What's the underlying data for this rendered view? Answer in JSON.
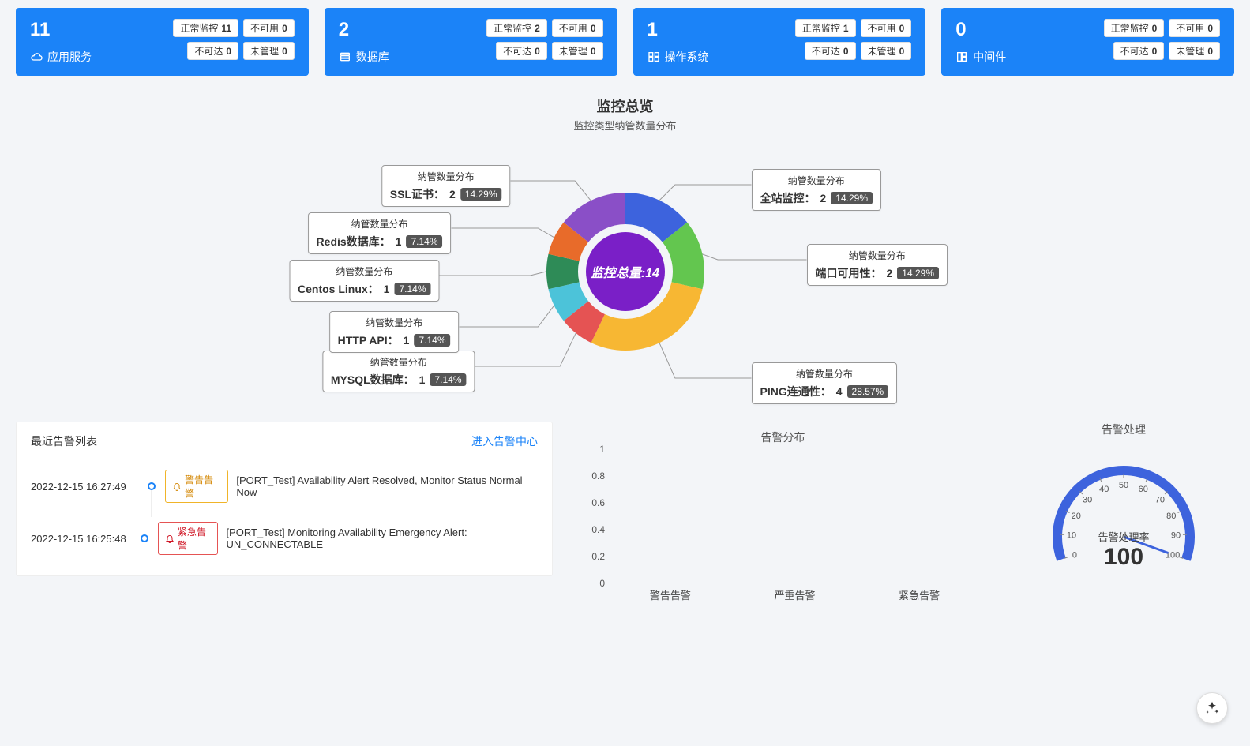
{
  "cards": [
    {
      "count": "11",
      "name": "应用服务",
      "tags": [
        {
          "label": "正常监控",
          "val": "11"
        },
        {
          "label": "不可用",
          "val": "0"
        },
        {
          "label": "不可达",
          "val": "0"
        },
        {
          "label": "未管理",
          "val": "0"
        }
      ]
    },
    {
      "count": "2",
      "name": "数据库",
      "tags": [
        {
          "label": "正常监控",
          "val": "2"
        },
        {
          "label": "不可用",
          "val": "0"
        },
        {
          "label": "不可达",
          "val": "0"
        },
        {
          "label": "未管理",
          "val": "0"
        }
      ]
    },
    {
      "count": "1",
      "name": "操作系统",
      "tags": [
        {
          "label": "正常监控",
          "val": "1"
        },
        {
          "label": "不可用",
          "val": "0"
        },
        {
          "label": "不可达",
          "val": "0"
        },
        {
          "label": "未管理",
          "val": "0"
        }
      ]
    },
    {
      "count": "0",
      "name": "中间件",
      "tags": [
        {
          "label": "正常监控",
          "val": "0"
        },
        {
          "label": "不可用",
          "val": "0"
        },
        {
          "label": "不可达",
          "val": "0"
        },
        {
          "label": "未管理",
          "val": "0"
        }
      ]
    }
  ],
  "overview": {
    "title": "监控总览",
    "subtitle": "监控类型纳管数量分布",
    "center_prefix": "监控总量:",
    "center_value": "14",
    "label_title": "纳管数量分布"
  },
  "chart_data": {
    "type": "pie",
    "title": "监控类型纳管数量分布",
    "total": 14,
    "series": [
      {
        "name": "全站监控",
        "value": 2,
        "percent": "14.29%",
        "color": "#3d63dd"
      },
      {
        "name": "端口可用性",
        "value": 2,
        "percent": "14.29%",
        "color": "#63c64f"
      },
      {
        "name": "PING连通性",
        "value": 4,
        "percent": "28.57%",
        "color": "#f7b733"
      },
      {
        "name": "MYSQL数据库",
        "value": 1,
        "percent": "7.14%",
        "color": "#e55353"
      },
      {
        "name": "HTTP API",
        "value": 1,
        "percent": "7.14%",
        "color": "#4cc3d9"
      },
      {
        "name": "Centos Linux",
        "value": 1,
        "percent": "7.14%",
        "color": "#2e8b57"
      },
      {
        "name": "Redis数据库",
        "value": 1,
        "percent": "7.14%",
        "color": "#e86b2a"
      },
      {
        "name": "SSL证书",
        "value": 2,
        "percent": "14.29%",
        "color": "#8a4fc7"
      }
    ]
  },
  "alerts": {
    "title": "最近告警列表",
    "link": "进入告警中心",
    "items": [
      {
        "time": "2022-12-15 16:27:49",
        "level_label": "警告告警",
        "level": "warn",
        "msg": "[PORT_Test] Availability Alert Resolved, Monitor Status Normal Now"
      },
      {
        "time": "2022-12-15 16:25:48",
        "level_label": "紧急告警",
        "level": "crit",
        "msg": "[PORT_Test] Monitoring Availability Emergency Alert: UN_CONNECTABLE"
      }
    ]
  },
  "dist_chart": {
    "title": "告警分布",
    "type": "bar",
    "categories": [
      "警告告警",
      "严重告警",
      "紧急告警"
    ],
    "values": [
      0,
      0,
      0
    ],
    "ylim": [
      0,
      1
    ],
    "yticks": [
      "0",
      "0.2",
      "0.4",
      "0.6",
      "0.8",
      "1"
    ]
  },
  "gauge": {
    "title": "告警处理",
    "label": "告警处理率",
    "value": "100",
    "ticks": [
      "0",
      "10",
      "20",
      "30",
      "40",
      "50",
      "60",
      "70",
      "80",
      "90",
      "100"
    ],
    "color": "#3d63dd"
  }
}
